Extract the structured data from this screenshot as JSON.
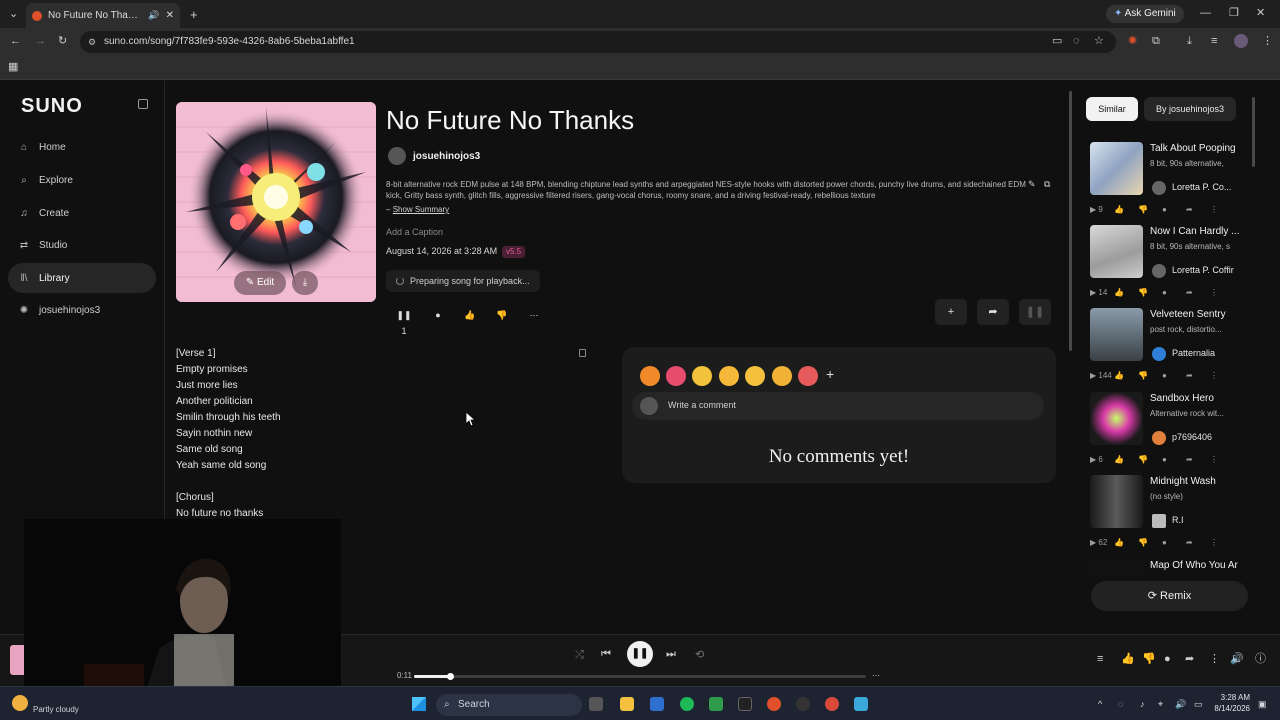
{
  "browser": {
    "tab_title": "No Future No Thanks by jos",
    "url": "suno.com/song/7f783fe9-593e-4326-8ab6-5beba1abffe1",
    "gemini_label": "Ask Gemini"
  },
  "sidebar": {
    "logo": "SUNO",
    "items": [
      {
        "label": "Home",
        "icon": "home-icon"
      },
      {
        "label": "Explore",
        "icon": "search-icon"
      },
      {
        "label": "Create",
        "icon": "music-note-icon"
      },
      {
        "label": "Studio",
        "icon": "studio-icon"
      },
      {
        "label": "Library",
        "icon": "library-icon",
        "active": true
      },
      {
        "label": "josuehinojos3",
        "icon": "user-icon"
      }
    ]
  },
  "song": {
    "title": "No Future No Thanks",
    "artist": "josuehinojos3",
    "description": "8-bit alternative rock EDM pulse at 148 BPM, blending chiptune lead synths and arpeggiated NES-style hooks with distorted power chords, punchy live drums, and sidechained EDM kick, Gritty bass synth, glitch fills, aggressive filtered risers, gang-vocal chorus, roomy snare, and a driving festival-ready, rebellious texture",
    "show_summary_prefix": "–",
    "show_summary": "Show Summary",
    "caption_placeholder": "Add a Caption",
    "date": "August 14, 2026 at 3:28 AM",
    "version": "v5.5",
    "preparing": "Preparing song for playback...",
    "edit_label": "Edit",
    "play_count": "1"
  },
  "lyrics": [
    "[Verse 1]",
    "Empty promises",
    "Just more lies",
    "Another politician",
    "Smilin through his teeth",
    "Sayin nothin new",
    "Same old song",
    "Yeah same old song",
    "",
    "[Chorus]",
    "No future no thanks"
  ],
  "comments": {
    "placeholder": "Write a comment",
    "empty": "No comments yet!",
    "emoji_colors": [
      "#f08a2a",
      "#e74c6c",
      "#f2c23a",
      "#f5b83a",
      "#f3c13c",
      "#f0b135",
      "#e65a5a"
    ]
  },
  "rail": {
    "tabs": [
      "Similar",
      "By josuehinojos3"
    ],
    "cards": [
      {
        "title": "Talk About Pooping",
        "style": "8 bit, 90s alternative,",
        "user": "Loretta P. Co...",
        "plays": "9"
      },
      {
        "title": "Now I Can Hardly ...",
        "style": "8 bit, 90s alternative, s",
        "user": "Loretta P. Coffir",
        "plays": "14"
      },
      {
        "title": "Velveteen Sentry",
        "style": "post rock, distortio...",
        "user": "Patternalia",
        "plays": "144"
      },
      {
        "title": "Sandbox Hero",
        "style": "Alternative rock wit...",
        "user": "p7696406",
        "plays": "6"
      },
      {
        "title": "Midnight Wash",
        "style": "(no style)",
        "user": "R.I",
        "plays": "62"
      },
      {
        "title": "Map Of Who You Ar",
        "style": "",
        "user": "",
        "plays": ""
      }
    ],
    "remix_label": "Remix"
  },
  "player": {
    "time": "0:11",
    "progress": 0.08
  },
  "taskbar": {
    "weather": "Partly cloudy",
    "search": "Search",
    "time": "3:28 AM",
    "date": "8/14/2026"
  }
}
